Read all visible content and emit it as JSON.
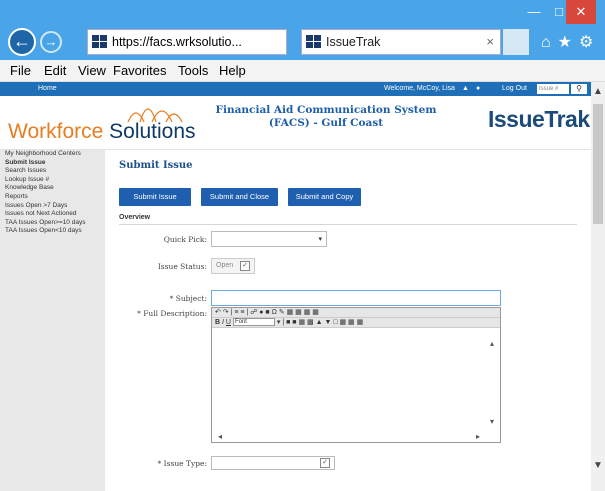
{
  "window": {
    "min_icon": "minimize-icon",
    "max_icon": "maximize-icon",
    "close_icon": "close-icon"
  },
  "browser": {
    "address_url": "https://facs.wrksolutio...",
    "address_tools": "⌕ ▾ 🔒 ↻",
    "tab_title": "IssueTrak",
    "tab_close": "×",
    "toolbar_icons": "⌂★⚙"
  },
  "menu": {
    "items": [
      "File",
      "Edit",
      "View",
      "Favorites",
      "Tools",
      "Help"
    ]
  },
  "site": {
    "home_label": "Home",
    "welcome": "Welcome, McCoy, Lisa",
    "logout": "Log Out",
    "issue_search_placeholder": "Issue #",
    "search_icon": "⚲",
    "logo_text_1": "Workforce ",
    "logo_text_2": "Solutions",
    "title": "Financial Aid Communication System (FACS) - Gulf Coast",
    "product_logo": "IssueTrak"
  },
  "sidebar": {
    "items": [
      "My Neighborhood Centers",
      "Submit Issue",
      "Search Issues",
      "Lookup Issue #",
      "Knowledge Base",
      "Reports",
      "Issues Open >7 Days",
      "Issues not Next Actioned",
      "TAA Issues Open>=10 days",
      "TAA Issues Open<10 days"
    ]
  },
  "form": {
    "title": "Submit Issue",
    "buttons": [
      "Submit Issue",
      "Submit and Close",
      "Submit and Copy"
    ],
    "overview": "Overview",
    "quick_pick_label": "Quick Pick:",
    "issue_status_label": "Issue Status:",
    "issue_status_value": "Open",
    "subject_label": "* Subject:",
    "full_description_label": "* Full Description:",
    "editor_font": "Font",
    "issue_type_label": "* Issue Type:"
  }
}
